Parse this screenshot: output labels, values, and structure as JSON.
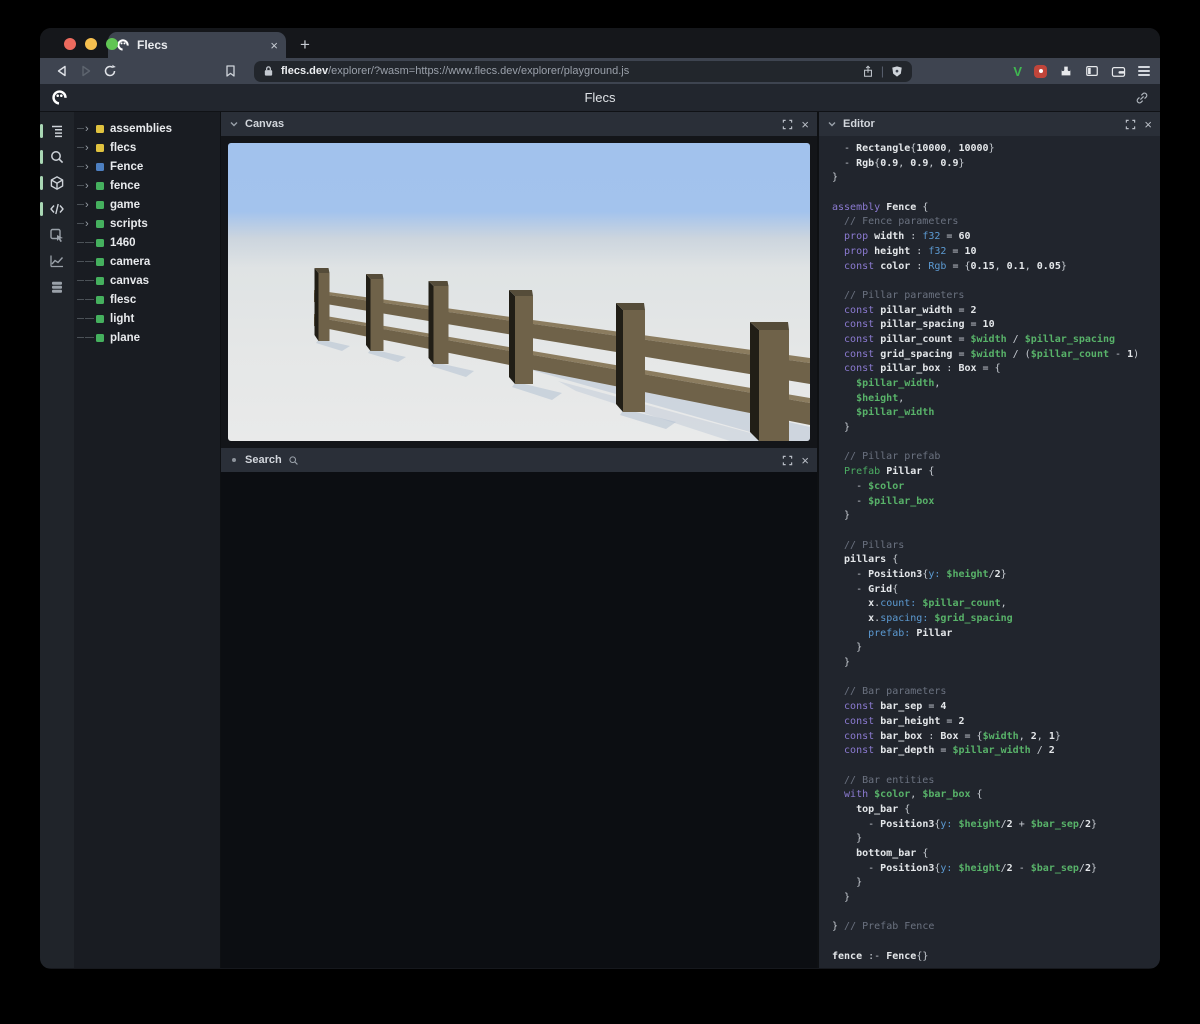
{
  "browser": {
    "tab_title": "Flecs",
    "close_tab_label": "×",
    "new_tab_label": "+",
    "url": "flecs.dev/explorer/?wasm=https://www.flecs.dev/explorer/playground.js",
    "url_host": "flecs.dev",
    "url_rest": "/explorer/?wasm=https://www.flecs.dev/explorer/playground.js",
    "extension_v_label": "V"
  },
  "header": {
    "title": "Flecs"
  },
  "panels": {
    "canvas": {
      "title": "Canvas",
      "close_label": "×"
    },
    "search": {
      "title": "Search",
      "close_label": "×"
    },
    "editor": {
      "title": "Editor",
      "close_label": "×"
    }
  },
  "colors": {
    "module_square": "#e0c23f",
    "prefab_square": "#4d7fc0",
    "entity_square": "#45b05e",
    "rail_active_pill": "#a9d7b4",
    "sky": "#a2c2ed",
    "ground": "#e5e7e7",
    "wood_front": "#6f6249",
    "wood_top": "#8b7c5f",
    "wood_dark": "#211e16",
    "shadow": "#aebdd0"
  },
  "rail": [
    {
      "name": "entities-tree-icon",
      "active": true
    },
    {
      "name": "query-search-icon",
      "active": true
    },
    {
      "name": "canvas-cube-icon",
      "active": true
    },
    {
      "name": "editor-code-icon",
      "active": true
    },
    {
      "name": "inspector-icon",
      "active": false
    },
    {
      "name": "stats-chart-icon",
      "active": false
    },
    {
      "name": "requests-stack-icon",
      "active": false
    }
  ],
  "sidebar": {
    "tree": [
      {
        "label": "assemblies",
        "square": "#e0c23f",
        "expandable": true
      },
      {
        "label": "flecs",
        "square": "#e0c23f",
        "expandable": true
      },
      {
        "label": "Fence",
        "square": "#4d7fc0",
        "expandable": true
      },
      {
        "label": "fence",
        "square": "#45b05e",
        "expandable": true
      },
      {
        "label": "game",
        "square": "#45b05e",
        "expandable": true
      },
      {
        "label": "scripts",
        "square": "#45b05e",
        "expandable": true
      },
      {
        "label": "1460",
        "square": "#45b05e",
        "expandable": false
      },
      {
        "label": "camera",
        "square": "#45b05e",
        "expandable": false
      },
      {
        "label": "canvas",
        "square": "#45b05e",
        "expandable": false
      },
      {
        "label": "flesc",
        "square": "#45b05e",
        "expandable": false
      },
      {
        "label": "light",
        "square": "#45b05e",
        "expandable": false
      },
      {
        "label": "plane",
        "square": "#45b05e",
        "expandable": false
      }
    ]
  },
  "editor": {
    "code_lines": [
      [
        [
          "p",
          "  - "
        ],
        [
          "i",
          "Rectangle"
        ],
        [
          "p",
          "{"
        ],
        [
          "n",
          "10000"
        ],
        [
          "p",
          ", "
        ],
        [
          "n",
          "10000"
        ],
        [
          "p",
          "}"
        ]
      ],
      [
        [
          "p",
          "  - "
        ],
        [
          "i",
          "Rgb"
        ],
        [
          "p",
          "{"
        ],
        [
          "n",
          "0.9"
        ],
        [
          "p",
          ", "
        ],
        [
          "n",
          "0.9"
        ],
        [
          "p",
          ", "
        ],
        [
          "n",
          "0.9"
        ],
        [
          "p",
          "}"
        ]
      ],
      [
        [
          "p",
          "}"
        ]
      ],
      [],
      [
        [
          "k",
          "assembly"
        ],
        [
          "p",
          " "
        ],
        [
          "i",
          "Fence"
        ],
        [
          "p",
          " {"
        ]
      ],
      [
        [
          "c",
          "  // Fence parameters"
        ]
      ],
      [
        [
          "k",
          "  prop"
        ],
        [
          "p",
          " "
        ],
        [
          "i",
          "width"
        ],
        [
          "p",
          " : "
        ],
        [
          "t",
          "f32"
        ],
        [
          "p",
          " = "
        ],
        [
          "n",
          "60"
        ]
      ],
      [
        [
          "k",
          "  prop"
        ],
        [
          "p",
          " "
        ],
        [
          "i",
          "height"
        ],
        [
          "p",
          " : "
        ],
        [
          "t",
          "f32"
        ],
        [
          "p",
          " = "
        ],
        [
          "n",
          "10"
        ]
      ],
      [
        [
          "k",
          "  const"
        ],
        [
          "p",
          " "
        ],
        [
          "i",
          "color"
        ],
        [
          "p",
          " : "
        ],
        [
          "t",
          "Rgb"
        ],
        [
          "p",
          " = {"
        ],
        [
          "n",
          "0.15"
        ],
        [
          "p",
          ", "
        ],
        [
          "n",
          "0.1"
        ],
        [
          "p",
          ", "
        ],
        [
          "n",
          "0.05"
        ],
        [
          "p",
          "}"
        ]
      ],
      [],
      [
        [
          "c",
          "  // Pillar parameters"
        ]
      ],
      [
        [
          "k",
          "  const"
        ],
        [
          "p",
          " "
        ],
        [
          "i",
          "pillar_width"
        ],
        [
          "p",
          " = "
        ],
        [
          "n",
          "2"
        ]
      ],
      [
        [
          "k",
          "  const"
        ],
        [
          "p",
          " "
        ],
        [
          "i",
          "pillar_spacing"
        ],
        [
          "p",
          " = "
        ],
        [
          "n",
          "10"
        ]
      ],
      [
        [
          "k",
          "  const"
        ],
        [
          "p",
          " "
        ],
        [
          "i",
          "pillar_count"
        ],
        [
          "p",
          " = "
        ],
        [
          "v",
          "$width"
        ],
        [
          "p",
          " / "
        ],
        [
          "v",
          "$pillar_spacing"
        ]
      ],
      [
        [
          "k",
          "  const"
        ],
        [
          "p",
          " "
        ],
        [
          "i",
          "grid_spacing"
        ],
        [
          "p",
          " = "
        ],
        [
          "v",
          "$width"
        ],
        [
          "p",
          " / ("
        ],
        [
          "v",
          "$pillar_count"
        ],
        [
          "p",
          " - "
        ],
        [
          "n",
          "1"
        ],
        [
          "p",
          ")"
        ]
      ],
      [
        [
          "k",
          "  const"
        ],
        [
          "p",
          " "
        ],
        [
          "i",
          "pillar_box"
        ],
        [
          "p",
          " : "
        ],
        [
          "i",
          "Box"
        ],
        [
          "p",
          " = {"
        ]
      ],
      [
        [
          "v",
          "    $pillar_width"
        ],
        [
          "p",
          ","
        ]
      ],
      [
        [
          "v",
          "    $height"
        ],
        [
          "p",
          ","
        ]
      ],
      [
        [
          "v",
          "    $pillar_width"
        ]
      ],
      [
        [
          "p",
          "  }"
        ]
      ],
      [],
      [
        [
          "c",
          "  // Pillar prefab"
        ]
      ],
      [
        [
          "g",
          "  Prefab"
        ],
        [
          "p",
          " "
        ],
        [
          "i",
          "Pillar"
        ],
        [
          "p",
          " {"
        ]
      ],
      [
        [
          "p",
          "    - "
        ],
        [
          "v",
          "$color"
        ]
      ],
      [
        [
          "p",
          "    - "
        ],
        [
          "v",
          "$pillar_box"
        ]
      ],
      [
        [
          "p",
          "  }"
        ]
      ],
      [],
      [
        [
          "c",
          "  // Pillars"
        ]
      ],
      [
        [
          "i",
          "  pillars"
        ],
        [
          "p",
          " {"
        ]
      ],
      [
        [
          "p",
          "    - "
        ],
        [
          "i",
          "Position3"
        ],
        [
          "p",
          "{"
        ],
        [
          "t",
          "y:"
        ],
        [
          "p",
          " "
        ],
        [
          "v",
          "$height"
        ],
        [
          "p",
          "/"
        ],
        [
          "n",
          "2"
        ],
        [
          "p",
          "}"
        ]
      ],
      [
        [
          "p",
          "    - "
        ],
        [
          "i",
          "Grid"
        ],
        [
          "p",
          "{"
        ]
      ],
      [
        [
          "i",
          "      x"
        ],
        [
          "p",
          "."
        ],
        [
          "t",
          "count:"
        ],
        [
          "p",
          " "
        ],
        [
          "v",
          "$pillar_count"
        ],
        [
          "p",
          ","
        ]
      ],
      [
        [
          "i",
          "      x"
        ],
        [
          "p",
          "."
        ],
        [
          "t",
          "spacing:"
        ],
        [
          "p",
          " "
        ],
        [
          "v",
          "$grid_spacing"
        ]
      ],
      [
        [
          "t",
          "      prefab:"
        ],
        [
          "p",
          " "
        ],
        [
          "i",
          "Pillar"
        ]
      ],
      [
        [
          "p",
          "    }"
        ]
      ],
      [
        [
          "p",
          "  }"
        ]
      ],
      [],
      [
        [
          "c",
          "  // Bar parameters"
        ]
      ],
      [
        [
          "k",
          "  const"
        ],
        [
          "p",
          " "
        ],
        [
          "i",
          "bar_sep"
        ],
        [
          "p",
          " = "
        ],
        [
          "n",
          "4"
        ]
      ],
      [
        [
          "k",
          "  const"
        ],
        [
          "p",
          " "
        ],
        [
          "i",
          "bar_height"
        ],
        [
          "p",
          " = "
        ],
        [
          "n",
          "2"
        ]
      ],
      [
        [
          "k",
          "  const"
        ],
        [
          "p",
          " "
        ],
        [
          "i",
          "bar_box"
        ],
        [
          "p",
          " : "
        ],
        [
          "i",
          "Box"
        ],
        [
          "p",
          " = {"
        ],
        [
          "v",
          "$width"
        ],
        [
          "p",
          ", "
        ],
        [
          "n",
          "2"
        ],
        [
          "p",
          ", "
        ],
        [
          "n",
          "1"
        ],
        [
          "p",
          "}"
        ]
      ],
      [
        [
          "k",
          "  const"
        ],
        [
          "p",
          " "
        ],
        [
          "i",
          "bar_depth"
        ],
        [
          "p",
          " = "
        ],
        [
          "v",
          "$pillar_width"
        ],
        [
          "p",
          " / "
        ],
        [
          "n",
          "2"
        ]
      ],
      [],
      [
        [
          "c",
          "  // Bar entities"
        ]
      ],
      [
        [
          "k",
          "  with"
        ],
        [
          "p",
          " "
        ],
        [
          "v",
          "$color"
        ],
        [
          "p",
          ", "
        ],
        [
          "v",
          "$bar_box"
        ],
        [
          "p",
          " {"
        ]
      ],
      [
        [
          "i",
          "    top_bar"
        ],
        [
          "p",
          " {"
        ]
      ],
      [
        [
          "p",
          "      - "
        ],
        [
          "i",
          "Position3"
        ],
        [
          "p",
          "{"
        ],
        [
          "t",
          "y:"
        ],
        [
          "p",
          " "
        ],
        [
          "v",
          "$height"
        ],
        [
          "p",
          "/"
        ],
        [
          "n",
          "2"
        ],
        [
          "p",
          " + "
        ],
        [
          "v",
          "$bar_sep"
        ],
        [
          "p",
          "/"
        ],
        [
          "n",
          "2"
        ],
        [
          "p",
          "}"
        ]
      ],
      [
        [
          "p",
          "    }"
        ]
      ],
      [
        [
          "i",
          "    bottom_bar"
        ],
        [
          "p",
          " {"
        ]
      ],
      [
        [
          "p",
          "      - "
        ],
        [
          "i",
          "Position3"
        ],
        [
          "p",
          "{"
        ],
        [
          "t",
          "y:"
        ],
        [
          "p",
          " "
        ],
        [
          "v",
          "$height"
        ],
        [
          "p",
          "/"
        ],
        [
          "n",
          "2"
        ],
        [
          "p",
          " - "
        ],
        [
          "v",
          "$bar_sep"
        ],
        [
          "p",
          "/"
        ],
        [
          "n",
          "2"
        ],
        [
          "p",
          "}"
        ]
      ],
      [
        [
          "p",
          "    }"
        ]
      ],
      [
        [
          "p",
          "  }"
        ]
      ],
      [],
      [
        [
          "p",
          "} "
        ],
        [
          "c",
          "// Prefab Fence"
        ]
      ],
      [],
      [
        [
          "i",
          "fence"
        ],
        [
          "p",
          " :- "
        ],
        [
          "i",
          "Fence"
        ],
        [
          "p",
          "{}"
        ]
      ]
    ]
  }
}
